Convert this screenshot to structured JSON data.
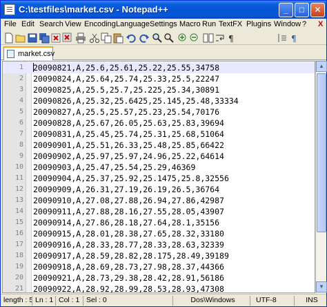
{
  "window": {
    "title": "C:\\testfiles\\market.csv - Notepad++",
    "min_glyph": "_",
    "max_glyph": "□",
    "close_glyph": "✕"
  },
  "menu": [
    "File",
    "Edit",
    "Search",
    "View",
    "Encoding",
    "Language",
    "Settings",
    "Macro",
    "Run",
    "TextFX",
    "Plugins",
    "Window",
    "?"
  ],
  "menu_close": "X",
  "toolbar_icons": [
    "new-file-icon",
    "open-folder-icon",
    "save-icon",
    "save-all-icon",
    "close-file-icon",
    "close-all-icon",
    "print-icon",
    "cut-icon",
    "copy-icon",
    "paste-icon",
    "undo-icon",
    "redo-icon",
    "find-icon",
    "replace-icon",
    "zoom-in-icon",
    "zoom-out-icon",
    "sync-icon",
    "wrap-icon",
    "show-all-chars-icon",
    "indent-guide-icon",
    "pilcrow-icon"
  ],
  "tab": {
    "label": "market.csv"
  },
  "lines": [
    {
      "num": "1",
      "text": "20090821,A,25.6,25.61,25.22,25.55,34758"
    },
    {
      "num": "2",
      "text": "20090824,A,25.64,25.74,25.33,25.5,22247"
    },
    {
      "num": "3",
      "text": "20090825,A,25.5,25.7,25.225,25.34,30891"
    },
    {
      "num": "4",
      "text": "20090826,A,25.32,25.6425,25.145,25.48,33334"
    },
    {
      "num": "5",
      "text": "20090827,A,25.5,25.57,25.23,25.54,70176"
    },
    {
      "num": "6",
      "text": "20090828,A,25.67,26.05,25.63,25.83,39694"
    },
    {
      "num": "7",
      "text": "20090831,A,25.45,25.74,25.31,25.68,51064"
    },
    {
      "num": "8",
      "text": "20090901,A,25.51,26.33,25.48,25.85,66422"
    },
    {
      "num": "9",
      "text": "20090902,A,25.97,25.97,24.96,25.22,64614"
    },
    {
      "num": "10",
      "text": "20090903,A,25.47,25.54,25.29,46369"
    },
    {
      "num": "11",
      "text": "20090904,A,25.37,25.92,25.1475,25.8,32556"
    },
    {
      "num": "12",
      "text": "20090909,A,26.31,27.19,26.19,26.5,36764"
    },
    {
      "num": "13",
      "text": "20090910,A,27.08,27.88,26.94,27.86,42987"
    },
    {
      "num": "14",
      "text": "20090911,A,27.88,28.16,27.55,28.05,43907"
    },
    {
      "num": "15",
      "text": "20090914,A,27.86,28.18,27.64,28.1,35156"
    },
    {
      "num": "16",
      "text": "20090915,A,28.01,28.38,27.65,28.32,33180"
    },
    {
      "num": "17",
      "text": "20090916,A,28.33,28.77,28.33,28.63,32339"
    },
    {
      "num": "18",
      "text": "20090917,A,28.59,28.82,28.175,28.49,39189"
    },
    {
      "num": "19",
      "text": "20090918,A,28.69,28.73,27.98,28.37,44366"
    },
    {
      "num": "20",
      "text": "20090921,A,28.73,29.38,28.42,28.91,56186"
    },
    {
      "num": "21",
      "text": "20090922,A,28.92,28.99,28.53,28.93,47308"
    },
    {
      "num": "22",
      "text": "20090923,A,28.59,28.83,28.27,44547"
    }
  ],
  "status": {
    "length": "length : 53",
    "ln": "Ln : 1",
    "col": "Col : 1",
    "sel": "Sel : 0",
    "eol": "Dos\\Windows",
    "encoding": "UTF-8",
    "mode": "INS"
  }
}
